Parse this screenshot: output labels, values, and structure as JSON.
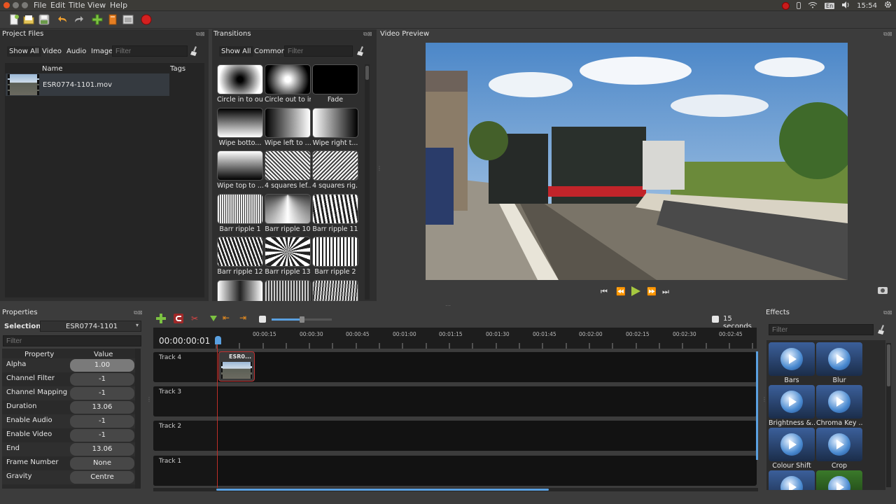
{
  "menubar": {
    "menus": [
      "File",
      "Edit",
      "Title",
      "View",
      "Help"
    ],
    "keyboard": "En",
    "clock": "15:54"
  },
  "toolbar": {
    "buttons": [
      "new-project",
      "open-project",
      "save-project",
      "undo",
      "redo",
      "import-files",
      "choose-profile",
      "fullscreen",
      "export-video"
    ]
  },
  "project_files": {
    "title": "Project Files",
    "tabs": [
      "Show All",
      "Video",
      "Audio",
      "Image"
    ],
    "filter_placeholder": "Filter",
    "columns": [
      "Name",
      "Tags"
    ],
    "files": [
      {
        "name": "ESR0774-1101.mov",
        "tags": ""
      }
    ]
  },
  "transitions": {
    "title": "Transitions",
    "tabs": [
      "Show All",
      "Common"
    ],
    "filter_placeholder": "Filter",
    "items": [
      "Circle in to out",
      "Circle out to in",
      "Fade",
      "Wipe botto...",
      "Wipe left to ...",
      "Wipe right t...",
      "Wipe top to ...",
      "4 squares lef...",
      "4 squares rig...",
      "Barr ripple 1",
      "Barr ripple 10",
      "Barr ripple 11",
      "Barr ripple 12",
      "Barr ripple 13",
      "Barr ripple 2",
      "",
      "",
      ""
    ]
  },
  "video_preview": {
    "title": "Video Preview",
    "controls": [
      "jump-start",
      "rewind",
      "play",
      "fast-forward",
      "jump-end"
    ]
  },
  "properties": {
    "title": "Properties",
    "selection_label": "Selection:",
    "selection_value": "ESR0774-1101",
    "filter_placeholder": "Filter",
    "col_property": "Property",
    "col_value": "Value",
    "rows": [
      {
        "name": "Alpha",
        "value": "1.00"
      },
      {
        "name": "Channel Filter",
        "value": "-1"
      },
      {
        "name": "Channel Mapping",
        "value": "-1"
      },
      {
        "name": "Duration",
        "value": "13.06"
      },
      {
        "name": "Enable Audio",
        "value": "-1"
      },
      {
        "name": "Enable Video",
        "value": "-1"
      },
      {
        "name": "End",
        "value": "13.06"
      },
      {
        "name": "Frame Number",
        "value": "None"
      },
      {
        "name": "Gravity",
        "value": "Centre"
      }
    ]
  },
  "timeline": {
    "timecode": "00:00:00:01",
    "zoom_label": "15 seconds",
    "ticks": [
      "00:00:15",
      "00:00:30",
      "00:00:45",
      "00:01:00",
      "00:01:15",
      "00:01:30",
      "00:01:45",
      "00:02:00",
      "00:02:15",
      "00:02:30",
      "00:02:45"
    ],
    "tracks": [
      "Track 4",
      "Track 3",
      "Track 2",
      "Track 1"
    ],
    "clip_label": "ESR0...",
    "zoom_fraction": 0.5
  },
  "effects": {
    "title": "Effects",
    "filter_placeholder": "Filter",
    "items": [
      "Bars",
      "Blur",
      "Brightness &...",
      "Chroma Key ...",
      "Colour Shift",
      "Crop"
    ]
  },
  "colors": {
    "bg": "#3c3c3c",
    "panel": "#2b2b2b",
    "accent": "#5aa0e0",
    "record": "#d42020",
    "playhead": "#c0302a"
  }
}
